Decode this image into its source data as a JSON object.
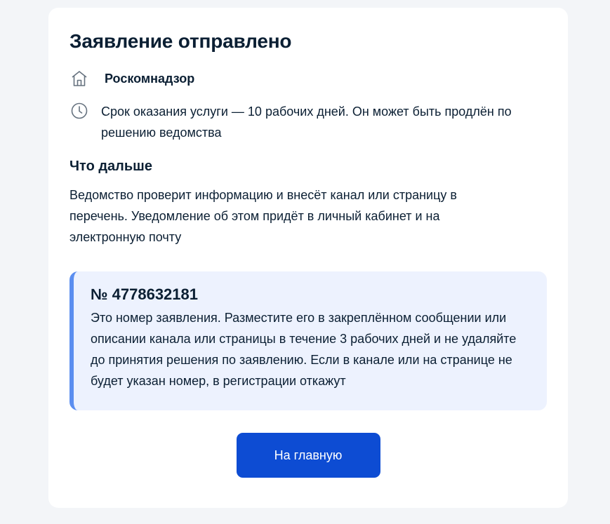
{
  "card": {
    "title": "Заявление отправлено",
    "organization": {
      "icon": "building-icon",
      "name": "Роскомнадзор"
    },
    "term": {
      "icon": "clock-icon",
      "text": "Срок оказания услуги — 10 рабочих дней. Он может быть продлён по решению ведомства"
    },
    "next_steps": {
      "heading": "Что дальше",
      "text": "Ведомство проверит информацию и внесёт канал или страницу в перечень. Уведомление об этом придёт в личный кабинет и на электронную почту"
    },
    "notice": {
      "number": "№ 4778632181",
      "text": "Это номер заявления. Разместите его в закреплённом сообщении или описании канала или страницы в течение 3 рабочих дней и не удаляйте до принятия решения по заявлению. Если в канале или на странице не будет указан номер, в регистрации откажут",
      "accent_color": "#5b8ef0",
      "background_color": "#edf2fe"
    },
    "home_button_label": "На главную"
  },
  "colors": {
    "page_background": "#f3f5f8",
    "button_primary": "#0d4cd3",
    "text": "#0b1f33"
  }
}
